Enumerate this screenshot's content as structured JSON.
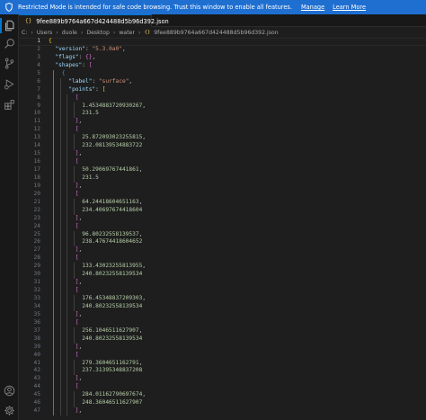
{
  "banner": {
    "message": "Restricted Mode is intended for safe code browsing. Trust this window to enable all features.",
    "manage": "Manage",
    "learn_more": "Learn More"
  },
  "tab": {
    "icon_text": "{}",
    "title": "9fee889b9764a667d424488d5b96d392.json"
  },
  "breadcrumb": {
    "parts": [
      "C:",
      "Users",
      "duole",
      "Desktop",
      "water"
    ],
    "file_icon_text": "{}",
    "file": "9fee889b9764a667d424488d5b96d392.json"
  },
  "editor": {
    "current_line": 1,
    "lines": [
      [
        [
          "b1",
          "{"
        ]
      ],
      [
        [
          "k",
          "  \"version\""
        ],
        [
          "p",
          ": "
        ],
        [
          "s",
          "\"5.3.0a0\""
        ],
        [
          "p",
          ","
        ]
      ],
      [
        [
          "k",
          "  \"flags\""
        ],
        [
          "p",
          ": "
        ],
        [
          "b2",
          "{}"
        ],
        [
          "p",
          ","
        ]
      ],
      [
        [
          "k",
          "  \"shapes\""
        ],
        [
          "p",
          ": "
        ],
        [
          "b2",
          "["
        ]
      ],
      [
        [
          "b3",
          "    {"
        ]
      ],
      [
        [
          "k",
          "      \"label\""
        ],
        [
          "p",
          ": "
        ],
        [
          "s",
          "\"surface\""
        ],
        [
          "p",
          ","
        ]
      ],
      [
        [
          "k",
          "      \"points\""
        ],
        [
          "p",
          ": "
        ],
        [
          "b1",
          "["
        ]
      ],
      [
        [
          "b2",
          "        ["
        ]
      ],
      [
        [
          "n",
          "          1.4534883720930267"
        ],
        [
          "p",
          ","
        ]
      ],
      [
        [
          "n",
          "          231.5"
        ]
      ],
      [
        [
          "b2",
          "        ]"
        ],
        [
          "p",
          ","
        ]
      ],
      [
        [
          "b2",
          "        ["
        ]
      ],
      [
        [
          "n",
          "          25.872093023255815"
        ],
        [
          "p",
          ","
        ]
      ],
      [
        [
          "n",
          "          232.08139534883722"
        ]
      ],
      [
        [
          "b2",
          "        ]"
        ],
        [
          "p",
          ","
        ]
      ],
      [
        [
          "b2",
          "        ["
        ]
      ],
      [
        [
          "n",
          "          50.29069767441861"
        ],
        [
          "p",
          ","
        ]
      ],
      [
        [
          "n",
          "          231.5"
        ]
      ],
      [
        [
          "b2",
          "        ]"
        ],
        [
          "p",
          ","
        ]
      ],
      [
        [
          "b2",
          "        ["
        ]
      ],
      [
        [
          "n",
          "          64.24418604651163"
        ],
        [
          "p",
          ","
        ]
      ],
      [
        [
          "n",
          "          234.40697674418604"
        ]
      ],
      [
        [
          "b2",
          "        ]"
        ],
        [
          "p",
          ","
        ]
      ],
      [
        [
          "b2",
          "        ["
        ]
      ],
      [
        [
          "n",
          "          96.80232558139537"
        ],
        [
          "p",
          ","
        ]
      ],
      [
        [
          "n",
          "          238.47674418604652"
        ]
      ],
      [
        [
          "b2",
          "        ]"
        ],
        [
          "p",
          ","
        ]
      ],
      [
        [
          "b2",
          "        ["
        ]
      ],
      [
        [
          "n",
          "          133.43023255813955"
        ],
        [
          "p",
          ","
        ]
      ],
      [
        [
          "n",
          "          240.80232558139534"
        ]
      ],
      [
        [
          "b2",
          "        ]"
        ],
        [
          "p",
          ","
        ]
      ],
      [
        [
          "b2",
          "        ["
        ]
      ],
      [
        [
          "n",
          "          176.45348837209303"
        ],
        [
          "p",
          ","
        ]
      ],
      [
        [
          "n",
          "          240.80232558139534"
        ]
      ],
      [
        [
          "b2",
          "        ]"
        ],
        [
          "p",
          ","
        ]
      ],
      [
        [
          "b2",
          "        ["
        ]
      ],
      [
        [
          "n",
          "          256.1046511627907"
        ],
        [
          "p",
          ","
        ]
      ],
      [
        [
          "n",
          "          240.80232558139534"
        ]
      ],
      [
        [
          "b2",
          "        ]"
        ],
        [
          "p",
          ","
        ]
      ],
      [
        [
          "b2",
          "        ["
        ]
      ],
      [
        [
          "n",
          "          279.3604651162791"
        ],
        [
          "p",
          ","
        ]
      ],
      [
        [
          "n",
          "          237.31395348837208"
        ]
      ],
      [
        [
          "b2",
          "        ]"
        ],
        [
          "p",
          ","
        ]
      ],
      [
        [
          "b2",
          "        ["
        ]
      ],
      [
        [
          "n",
          "          284.01162790697674"
        ],
        [
          "p",
          ","
        ]
      ],
      [
        [
          "n",
          "          248.36046511627907"
        ]
      ],
      [
        [
          "b2",
          "        ]"
        ],
        [
          "p",
          ","
        ]
      ]
    ]
  },
  "activity_bar": {
    "items": [
      "explorer-icon",
      "search-icon",
      "source-control-icon",
      "run-debug-icon",
      "extensions-icon"
    ],
    "bottom": [
      "account-icon",
      "settings-gear-icon"
    ]
  },
  "colors": {
    "banner_bg": "#1f6fd1",
    "editor_bg": "#1e1e1e",
    "key": "#9cdcfe",
    "string": "#ce9178",
    "number": "#b5cea8",
    "bracket_gold": "#ffd700",
    "bracket_pink": "#da70d6",
    "bracket_blue": "#179fff"
  }
}
